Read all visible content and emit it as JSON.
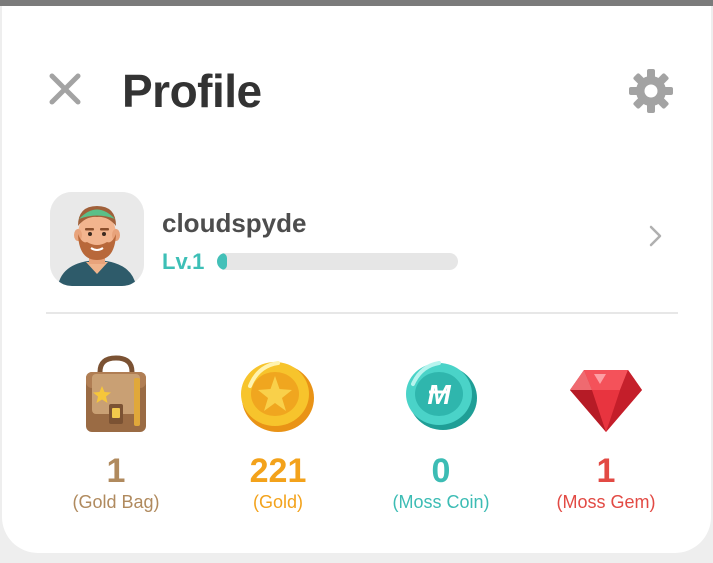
{
  "header": {
    "title": "Profile",
    "close_icon": "close-icon",
    "settings_icon": "gear-icon"
  },
  "user": {
    "username": "cloudspyde",
    "level": "Lv.1",
    "xp_progress": 0.04,
    "avatar": "avatar-bearded-man",
    "chevron_icon": "chevron-right-icon"
  },
  "stats": [
    {
      "value": "1",
      "label": "(Gold Bag)",
      "color": "#b08a5e",
      "icon": "gold-bag-icon"
    },
    {
      "value": "221",
      "label": "(Gold)",
      "color": "#f3a21b",
      "icon": "gold-coin-icon"
    },
    {
      "value": "0",
      "label": "(Moss Coin)",
      "color": "#3cbcb4",
      "icon": "moss-coin-icon"
    },
    {
      "value": "1",
      "label": "(Moss Gem)",
      "color": "#e24a44",
      "icon": "moss-gem-icon"
    }
  ],
  "colors": {
    "accent": "#3dbfb6",
    "title": "#333333",
    "icon_gray": "#a3a3a3"
  }
}
